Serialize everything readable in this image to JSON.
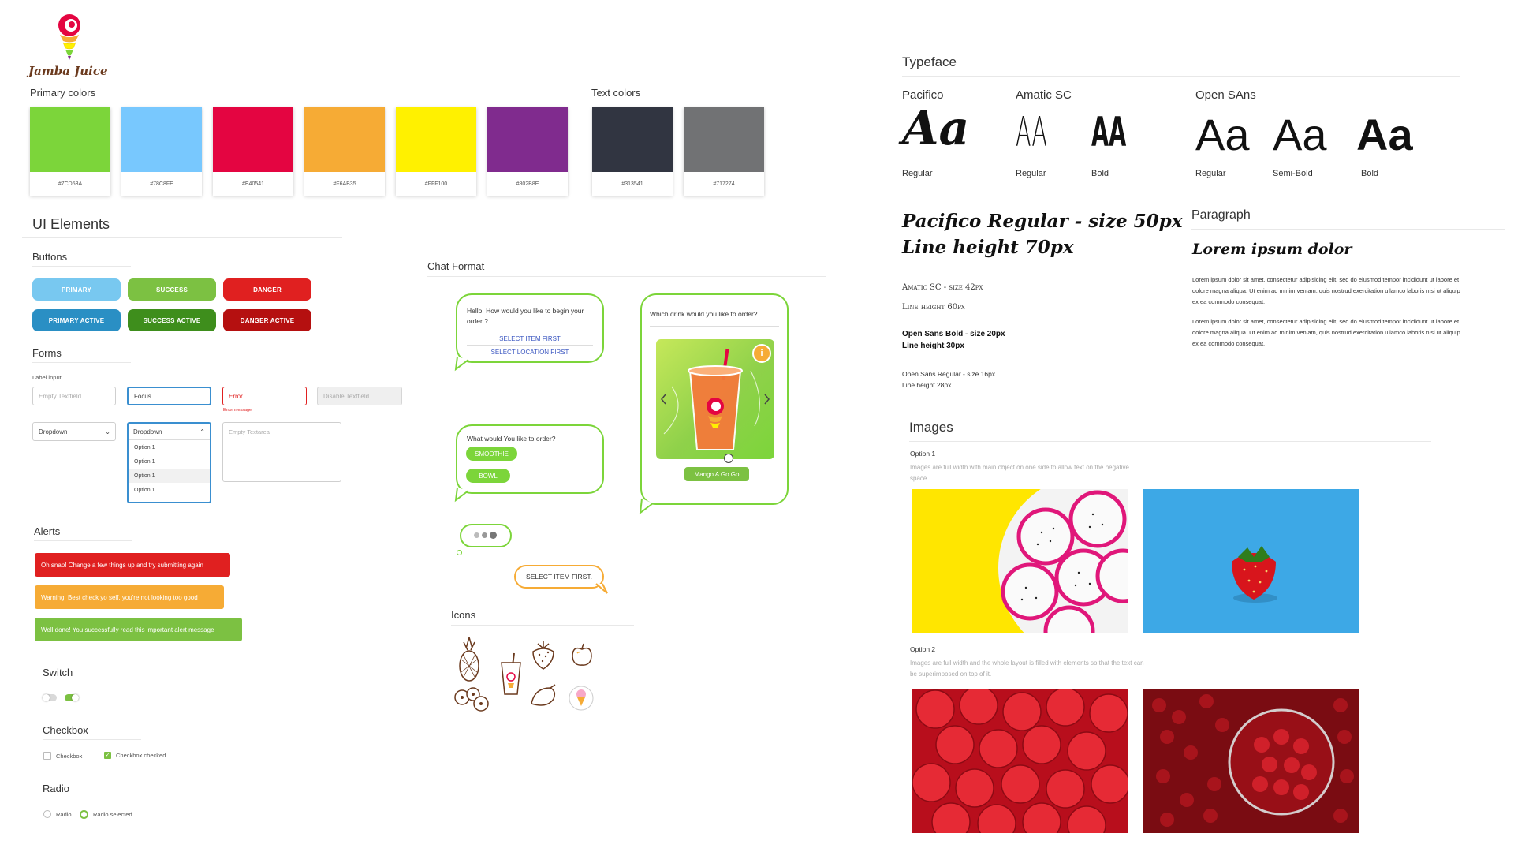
{
  "brand": {
    "logo_text": "Jamba Juice"
  },
  "primary_colors": {
    "title": "Primary colors",
    "swatches": [
      {
        "hex": "#7CD53A"
      },
      {
        "hex": "#78C8FE"
      },
      {
        "hex": "#E40541"
      },
      {
        "hex": "#F6AB35"
      },
      {
        "hex": "#FFF100"
      },
      {
        "hex": "#802B8E"
      }
    ]
  },
  "text_colors": {
    "title": "Text colors",
    "swatches": [
      {
        "hex": "#313541"
      },
      {
        "hex": "#717274"
      }
    ]
  },
  "ui_elements": {
    "title": "UI Elements",
    "buttons": {
      "title": "Buttons",
      "items": [
        {
          "label": "PRIMARY",
          "color": "#78C8F0"
        },
        {
          "label": "SUCCESS",
          "color": "#7CC142"
        },
        {
          "label": "DANGER",
          "color": "#E02020"
        },
        {
          "label": "PRIMARY ACTIVE",
          "color": "#2A8FC4"
        },
        {
          "label": "SUCCESS ACTIVE",
          "color": "#3E8E1C"
        },
        {
          "label": "DANGER ACTIVE",
          "color": "#B51010"
        }
      ]
    },
    "forms": {
      "title": "Forms",
      "label_input": "Label input",
      "empty_placeholder": "Empty Textfield",
      "focus_value": "Focus",
      "error_value": "Error",
      "error_message": "Error message",
      "disabled_placeholder": "Disable Textfield",
      "dropdown_label": "Dropdown",
      "dropdown_open_label": "Dropdown",
      "dropdown_options": [
        "Option 1",
        "Option 1",
        "Option 1",
        "Option 1"
      ],
      "textarea_placeholder": "Empty Textarea"
    },
    "alerts": {
      "title": "Alerts",
      "danger": "Oh snap! Change a few things up and try submitting again",
      "warning": "Warning! Best check yo self, you're not looking too good",
      "success": "Well done! You successfully read this important alert message"
    },
    "switch": {
      "title": "Switch"
    },
    "checkbox": {
      "title": "Checkbox",
      "unchecked": "Checkbox",
      "checked": "Checkbox checked"
    },
    "radio": {
      "title": "Radio",
      "unselected": "Radio",
      "selected": "Radio selected"
    }
  },
  "chat": {
    "title": "Chat Format",
    "bubble1": {
      "text": "Hello. How would you like to begin your order ?",
      "link1": "SELECT ITEM FIRST",
      "link2": "SELECT LOCATION FIRST"
    },
    "bubble2": {
      "text": "What would You like to order?",
      "btn1": "SMOOTHIE",
      "btn2": "BOWL"
    },
    "bubble3": {
      "text": "Which drink would you like to order?",
      "button": "Mango A Go Go",
      "info": "i"
    },
    "reply": "SELECT ITEM FIRST."
  },
  "icons": {
    "title": "Icons",
    "items": [
      "pineapple-icon",
      "smoothie-cup-icon",
      "strawberry-icon",
      "apple-icon",
      "berries-icon",
      "mango-icon",
      "ice-cream-icon"
    ]
  },
  "typeface": {
    "title": "Typeface",
    "fonts": [
      {
        "name": "Pacifico",
        "sample": "Aa",
        "weight_label": "Regular"
      },
      {
        "name": "Amatic SC",
        "sample": "AA",
        "weight_label": "Regular",
        "bold_label": "Bold"
      },
      {
        "name": "Open SAns",
        "sample": "Aa",
        "weight_labels": [
          "Regular",
          "Semi-Bold",
          "Bold"
        ]
      }
    ],
    "specimen_line1": "Pacifico Regular - size 50px",
    "specimen_line2": "Line height 70px",
    "amatic_line1": "Amatic SC - size 42px",
    "amatic_line2": "Line height 60px",
    "os_bold_line1": "Open Sans Bold - size 20px",
    "os_bold_line2": "Line height 30px",
    "os_reg_line1": "Open Sans Regular - size 16px",
    "os_reg_line2": "Line height 28px"
  },
  "paragraph": {
    "title": "Paragraph",
    "heading": "Lorem ipsum dolor",
    "p1": "Lorem ipsum dolor sit amet, consectetur adipisicing elit, sed do eiusmod tempor incididunt ut labore et dolore magna aliqua. Ut enim ad minim veniam, quis nostrud exercitation ullamco laboris nisi ut aliquip ex ea commodo consequat.",
    "p2": "Lorem ipsum dolor sit amet, consectetur adipisicing elit, sed do eiusmod tempor incididunt ut labore et dolore magna aliqua. Ut enim ad minim veniam, quis nostrud exercitation ullamco laboris nisi ut aliquip ex ea commodo consequat."
  },
  "images": {
    "title": "Images",
    "option1_title": "Option 1",
    "option1_desc": "Images are full width with main object on one side to allow text on the negative space.",
    "option2_title": "Option 2",
    "option2_desc": "Images are full width and the whole layout is filled with elements so that the text can be superimposed on top of it."
  }
}
